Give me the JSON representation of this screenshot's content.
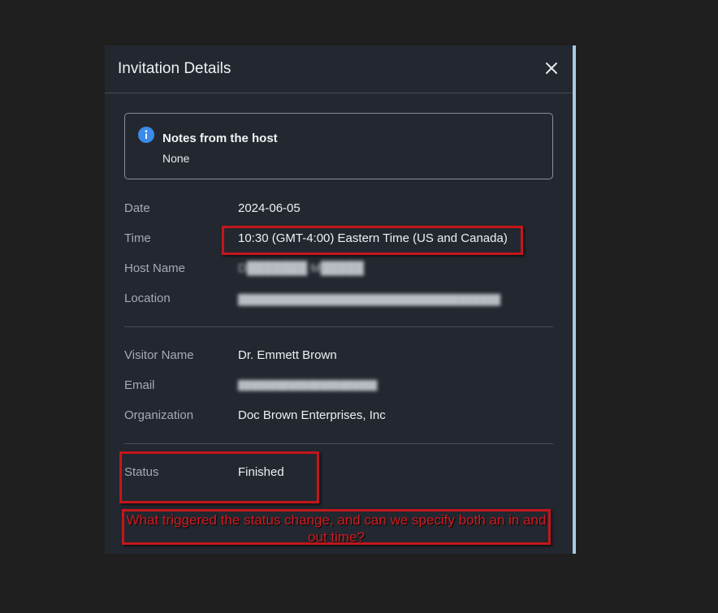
{
  "dialog": {
    "title": "Invitation Details",
    "close_icon": "close-icon"
  },
  "notes": {
    "icon": "info-icon",
    "title": "Notes from the host",
    "value": "None"
  },
  "details": [
    {
      "label": "Date",
      "value": "2024-06-05"
    },
    {
      "label": "Time",
      "value": "10:30 (GMT-4:00) Eastern Time (US and Canada)"
    },
    {
      "label": "Host Name",
      "value": "D███████ M█████"
    },
    {
      "label": "Location",
      "value": "██████████████████████████████████████"
    }
  ],
  "visitor": [
    {
      "label": "Visitor Name",
      "value": "Dr. Emmett Brown"
    },
    {
      "label": "Email",
      "value": "██████████████████████"
    },
    {
      "label": "Organization",
      "value": "Doc Brown Enterprises, Inc"
    }
  ],
  "status": {
    "label": "Status",
    "value": "Finished"
  },
  "annotation": {
    "text": "What triggered the status change, and can we specify both an in and out time?"
  },
  "colors": {
    "annotation_red": "#c4161c",
    "dialog_bg": "#232830",
    "accent_blue": "#3b8bea"
  }
}
